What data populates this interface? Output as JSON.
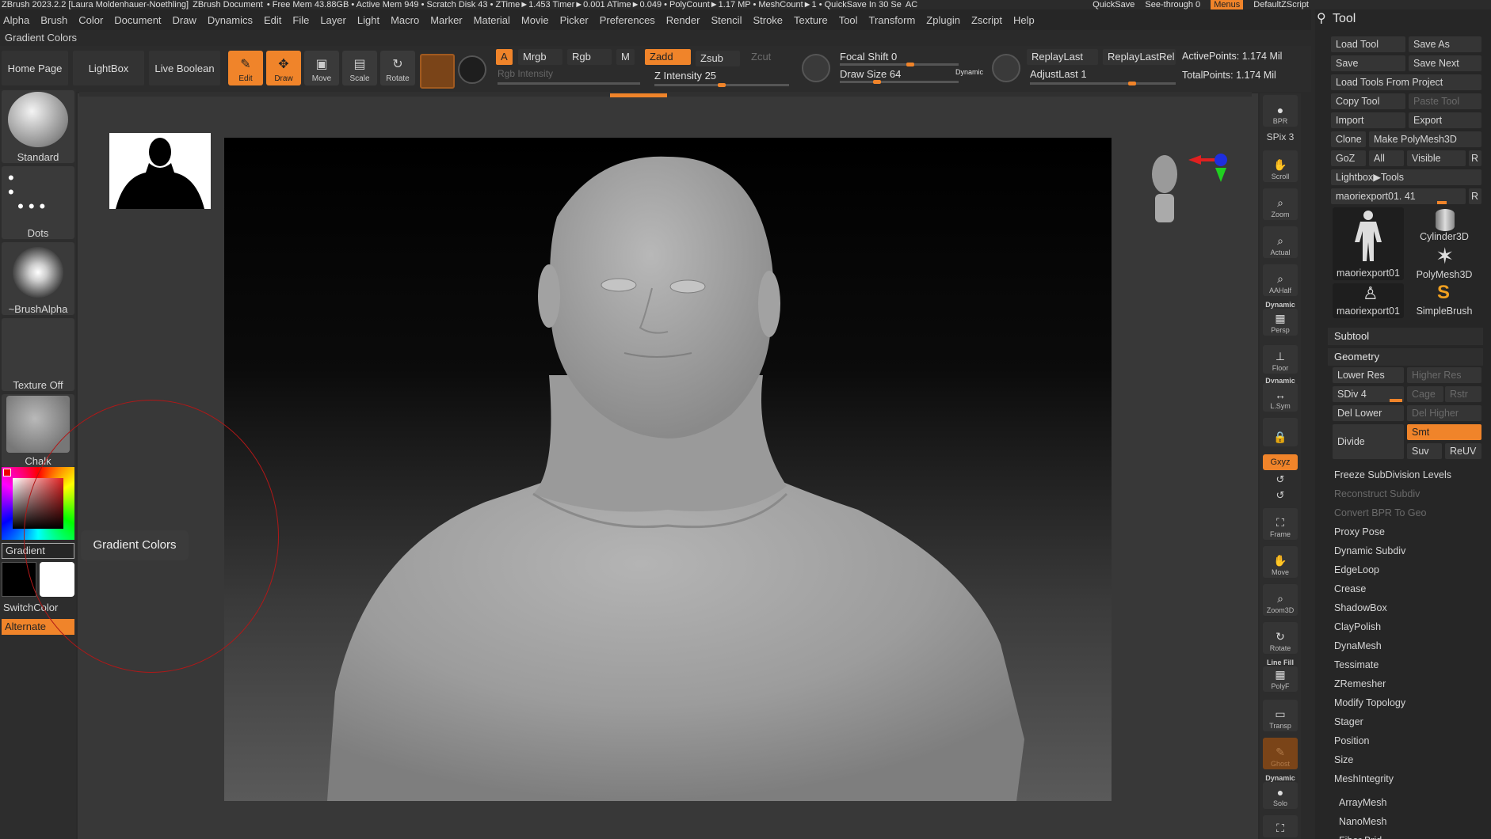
{
  "titlebar": {
    "app": "ZBrush 2023.2.2 [Laura Moldenhauer-Noethling]",
    "doc": "ZBrush Document",
    "stats": "• Free Mem 43.88GB • Active Mem 949 • Scratch Disk 43 • ZTime►1.453 Timer►0.001 ATime►0.049 • PolyCount►1.17 MP • MeshCount►1 • QuickSave In 30 Se",
    "ac": "AC",
    "quicksave": "QuickSave",
    "see_through": "See-through 0",
    "menus": "Menus",
    "script": "DefaultZScript"
  },
  "menubar": [
    "Alpha",
    "Brush",
    "Color",
    "Document",
    "Draw",
    "Dynamics",
    "Edit",
    "File",
    "Layer",
    "Light",
    "Macro",
    "Marker",
    "Material",
    "Movie",
    "Picker",
    "Preferences",
    "Render",
    "Stencil",
    "Stroke",
    "Texture",
    "Tool",
    "Transform",
    "Zplugin",
    "Zscript",
    "Help"
  ],
  "palette_title": "Gradient Colors",
  "shelf": {
    "home": "Home Page",
    "lightbox": "LightBox",
    "live_boolean": "Live Boolean",
    "edit": "Edit",
    "draw": "Draw",
    "move": "Move",
    "scale": "Scale",
    "rotate": "Rotate",
    "a": "A",
    "mrgb": "Mrgb",
    "rgb": "Rgb",
    "m": "M",
    "zadd": "Zadd",
    "zsub": "Zsub",
    "zcut": "Zcut",
    "rgb_intensity": "Rgb Intensity",
    "z_intensity": "Z Intensity 25",
    "focal_shift": "Focal Shift 0",
    "draw_size": "Draw Size 64",
    "dynamic": "Dynamic",
    "replay_last": "ReplayLast",
    "replay_last_rel": "ReplayLastRel",
    "adjust_last": "AdjustLast 1",
    "active_points": "ActivePoints: 1.174 Mil",
    "total_points": "TotalPoints: 1.174 Mil"
  },
  "left_tray": {
    "brush": "Standard",
    "stroke": "Dots",
    "alpha": "~BrushAlpha",
    "texture": "Texture Off",
    "material": "Chalk",
    "gradient": "Gradient",
    "switch_color": "SwitchColor",
    "alternate": "Alternate"
  },
  "tooltip": "Gradient Colors",
  "right_toolbar": {
    "bpr": "BPR",
    "spix": "SPix 3",
    "scroll": "Scroll",
    "zoom": "Zoom",
    "actual": "Actual",
    "aahalf": "AAHalf",
    "dynamic": "Dynamic",
    "persp": "Persp",
    "floor": "Floor",
    "lsym": "L.Sym",
    "xyz": "Gxyz",
    "frame": "Frame",
    "move": "Move",
    "zoom3d": "Zoom3D",
    "rotate": "Rotate",
    "line_fill": "Line Fill",
    "polyf": "PolyF",
    "transp": "Transp",
    "ghost": "Ghost",
    "solo": "Solo"
  },
  "tool_panel": {
    "header": "Tool",
    "load_tool": "Load Tool",
    "save_as": "Save As",
    "save": "Save",
    "save_next": "Save Next",
    "load_from_project": "Load Tools From Project",
    "copy_tool": "Copy Tool",
    "paste_tool": "Paste Tool",
    "import": "Import",
    "export": "Export",
    "clone": "Clone",
    "make_polymesh": "Make PolyMesh3D",
    "goz": "GoZ",
    "all": "All",
    "visible": "Visible",
    "r": "R",
    "lightbox_tools": "Lightbox▶Tools",
    "current_tool": "maoriexport01. 41",
    "thumbs": [
      "maoriexport01",
      "Cylinder3D",
      "PolyMesh3D",
      "maoriexport01",
      "SimpleBrush"
    ],
    "subtool": "Subtool",
    "geometry": "Geometry",
    "lower_res": "Lower Res",
    "higher_res": "Higher Res",
    "sdiv": "SDiv 4",
    "cage": "Cage",
    "rstr": "Rstr",
    "del_lower": "Del Lower",
    "del_higher": "Del Higher",
    "divide": "Divide",
    "smt": "Smt",
    "suv": "Suv",
    "reuv": "ReUV",
    "items": [
      "Freeze SubDivision Levels",
      "Reconstruct Subdiv",
      "Convert BPR To Geo",
      "Proxy Pose",
      "Dynamic Subdiv",
      "EdgeLoop",
      "Crease",
      "ShadowBox",
      "ClayPolish",
      "DynaMesh",
      "Tessimate",
      "ZRemesher",
      "Modify Topology",
      "Stager",
      "Position",
      "Size",
      "MeshIntegrity"
    ],
    "array_mesh": "ArrayMesh",
    "nano_mesh": "NanoMesh",
    "fibermesh_partial": "Fiber Brid"
  },
  "colors": {
    "accent": "#f0842a",
    "bg": "#2a2a2a",
    "circle": "#b01818"
  }
}
